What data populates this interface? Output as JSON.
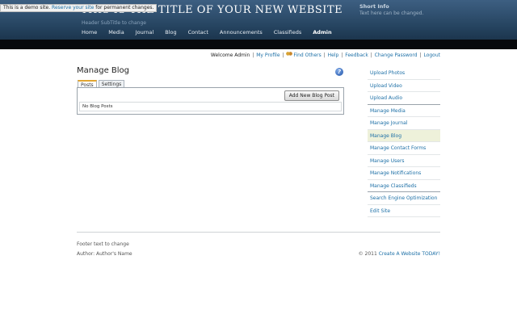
{
  "header": {
    "title": "THIS IS THE TITLE OF YOUR NEW WEBSITE",
    "subtitle": "Header SubTitle to change",
    "short_info_title": "Short Info",
    "short_info_text": "Text here can be changed."
  },
  "demo_notice": {
    "prefix": "This is a demo site.",
    "link": "Reserve your site",
    "suffix": "for permanent changes."
  },
  "nav": [
    "Home",
    "Media",
    "Journal",
    "Blog",
    "Contact",
    "Announcements",
    "Classifieds",
    "Admin"
  ],
  "userbar": {
    "welcome": "Welcome Admin",
    "links": [
      "My Profile",
      "Find Others",
      "Help",
      "Feedback",
      "Change Password",
      "Logout"
    ],
    "separator": "|"
  },
  "main": {
    "title": "Manage Blog",
    "help_icon_glyph": "?",
    "tabs": [
      "Posts",
      "Settings"
    ],
    "add_button": "Add New Blog Post",
    "empty_text": "No Blog Posts"
  },
  "sidebar": [
    "Upload Photos",
    "Upload Video",
    "Upload Audio",
    "Manage Media",
    "Manage Journal",
    "Manage Blog",
    "Manage Contact Forms",
    "Manage Users",
    "Manage Notifications",
    "Manage Classifieds",
    "Search Engine Optimization",
    "Edit Site"
  ],
  "footer": {
    "text": "Footer text to change",
    "author": "Author: Author's Name",
    "copyright": "© 2011",
    "copyright_link": "Create A Website TODAY!"
  },
  "colors": {
    "header_top": "#3d5f82",
    "header_bottom": "#152b40",
    "link": "#1c6fa6",
    "active_tab_accent": "#e2a632",
    "active_sidebar_bg": "#eef1da"
  }
}
